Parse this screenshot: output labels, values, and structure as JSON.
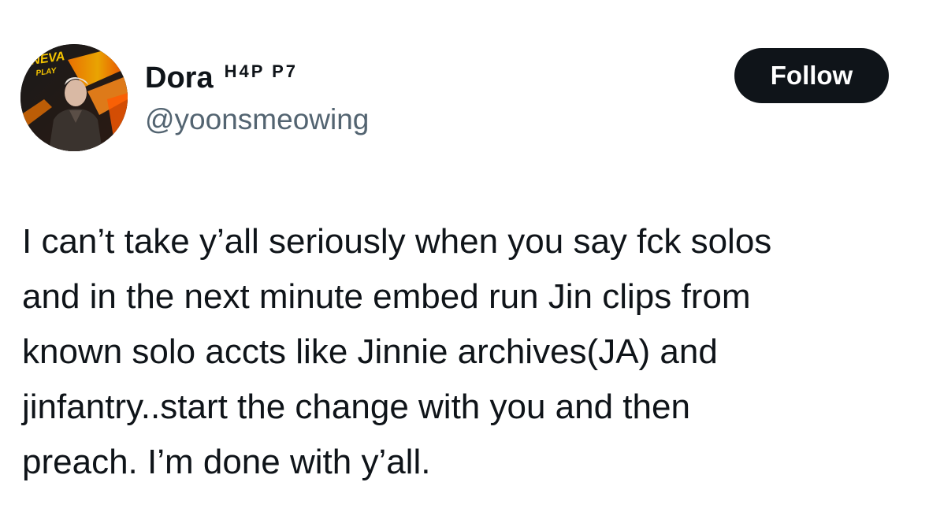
{
  "author": {
    "display_name": "Dora",
    "name_suffix": "H4P P7",
    "handle": "@yoonsmeowing",
    "avatar": {
      "icon": "profile-photo",
      "overlay_text_1": "NEVA",
      "overlay_text_2": "PLAY"
    }
  },
  "actions": {
    "follow_label": "Follow"
  },
  "tweet": {
    "lines": [
      "I can’t take y’all seriously when you say fck solos",
      "and in the next minute embed run Jin clips from",
      "known solo accts like Jinnie archives(JA) and",
      "jinfantry..start the change with you and then",
      "preach. I’m done with y’all."
    ]
  },
  "colors": {
    "text_primary": "#0f1419",
    "text_secondary": "#536471",
    "button_bg": "#0f1419",
    "button_text": "#ffffff",
    "background": "#ffffff"
  }
}
